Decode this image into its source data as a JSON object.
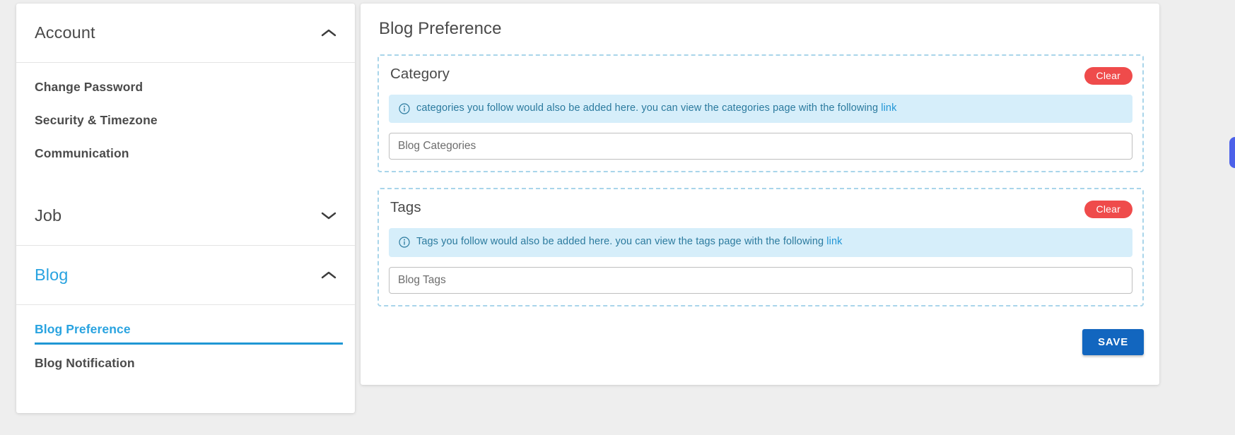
{
  "colors": {
    "accent_blue": "#29a3e0",
    "danger_red": "#ef4b4b",
    "save_blue": "#1266bf",
    "alert_bg": "#d6eefa",
    "alert_text": "#2b7a9e",
    "dashed_border": "#a9d5ea",
    "page_bg": "#eeeeee",
    "card_bg": "#ffffff",
    "text_dark": "#4a4a4a"
  },
  "sidebar": {
    "groups": [
      {
        "title": "Account",
        "expanded": true,
        "chevron": "chevron-up-icon",
        "items": [
          {
            "label": "Change Password",
            "active": false
          },
          {
            "label": "Security & Timezone",
            "active": false
          },
          {
            "label": "Communication",
            "active": false
          }
        ]
      },
      {
        "title": "Job",
        "expanded": false,
        "chevron": "chevron-down-icon",
        "items": []
      },
      {
        "title": "Blog",
        "expanded": true,
        "chevron": "chevron-up-icon",
        "items": [
          {
            "label": "Blog Preference",
            "active": true
          },
          {
            "label": "Blog Notification",
            "active": false
          }
        ]
      }
    ]
  },
  "main": {
    "page_title": "Blog Preference",
    "sections": [
      {
        "legend": "Category",
        "clear_label": "Clear",
        "alert": {
          "icon": "info-circle-icon",
          "text": "categories you follow would also be added here. you can view the categories page with the following ",
          "link_label": "link"
        },
        "input": {
          "placeholder": "Blog Categories",
          "value": ""
        }
      },
      {
        "legend": "Tags",
        "clear_label": "Clear",
        "alert": {
          "icon": "info-circle-icon",
          "text": "Tags you follow would also be added here. you can view the tags page with the following ",
          "link_label": "link"
        },
        "input": {
          "placeholder": "Blog Tags",
          "value": ""
        }
      }
    ],
    "save_label": "SAVE"
  },
  "edge_widget": {
    "name": "floating-chat-tab"
  }
}
